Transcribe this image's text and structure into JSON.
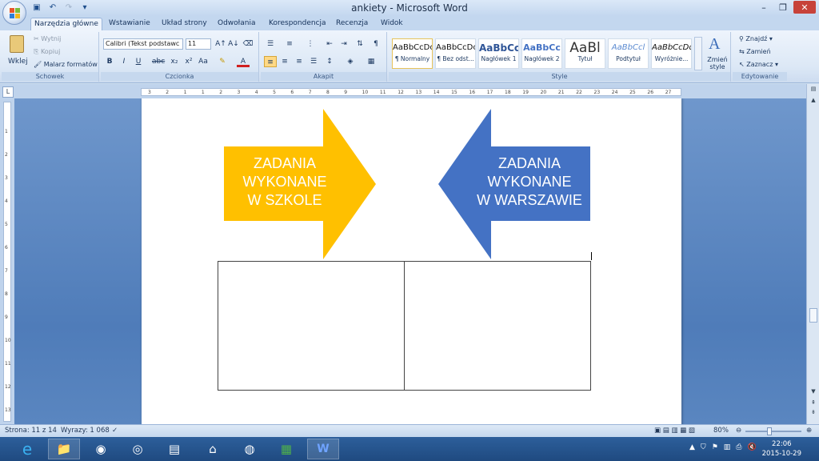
{
  "window": {
    "title": "ankiety - Microsoft Word",
    "qat": [
      "save-icon",
      "undo-icon",
      "redo-icon",
      "customize-icon"
    ],
    "controls": [
      "minimize",
      "restore",
      "close"
    ]
  },
  "tabs": [
    "Narzędzia główne",
    "Wstawianie",
    "Układ strony",
    "Odwołania",
    "Korespondencja",
    "Recenzja",
    "Widok"
  ],
  "ribbon": {
    "clipboard": {
      "label": "Schowek",
      "paste": "Wklej",
      "cut": "Wytnij",
      "copy": "Kopiuj",
      "format_painter": "Malarz formatów"
    },
    "font": {
      "label": "Czcionka",
      "font_name": "Calibri (Tekst podstawc",
      "font_size": "11"
    },
    "paragraph": {
      "label": "Akapit"
    },
    "styles": {
      "label": "Style",
      "items": [
        {
          "preview": "AaBbCcDc",
          "name": "¶ Normalny"
        },
        {
          "preview": "AaBbCcDc",
          "name": "¶ Bez odst..."
        },
        {
          "preview": "AaBbCc",
          "name": "Nagłówek 1"
        },
        {
          "preview": "AaBbCc",
          "name": "Nagłówek 2"
        },
        {
          "preview": "AaBl",
          "name": "Tytuł"
        },
        {
          "preview": "AaBbCcl",
          "name": "Podtytuł"
        },
        {
          "preview": "AaBbCcDc",
          "name": "Wyróżnie..."
        }
      ],
      "change_styles": "Zmień style"
    },
    "editing": {
      "label": "Edytowanie",
      "find": "Znajdź",
      "replace": "Zamień",
      "select": "Zaznacz"
    }
  },
  "ruler_ticks": [
    "3",
    "2",
    "1",
    "1",
    "2",
    "3",
    "4",
    "5",
    "6",
    "7",
    "8",
    "9",
    "10",
    "11",
    "12",
    "13",
    "14",
    "15",
    "16",
    "17",
    "18",
    "19",
    "20",
    "21",
    "22",
    "23",
    "24",
    "25",
    "26",
    "27"
  ],
  "document": {
    "left_arrow": {
      "line1": "ZADANIA",
      "line2": "WYKONANE",
      "line3": "W SZKOLE",
      "color": "#FFC000"
    },
    "right_arrow": {
      "line1": "ZADANIA",
      "line2": "WYKONANE",
      "line3": "W WARSZAWIE",
      "color": "#4472C4"
    },
    "table": {
      "columns": 2,
      "rows": 1
    }
  },
  "status": {
    "page": "Strona: 11 z 14",
    "words": "Wyrazy: 1 068",
    "zoom": "80%"
  },
  "taskbar": {
    "apps": [
      "ie-icon",
      "explorer-icon",
      "media-icon",
      "speaker-icon",
      "docs-icon",
      "home-icon",
      "chrome-icon",
      "excel-icon",
      "word-icon"
    ],
    "time": "22:06",
    "date": "2015-10-29"
  }
}
